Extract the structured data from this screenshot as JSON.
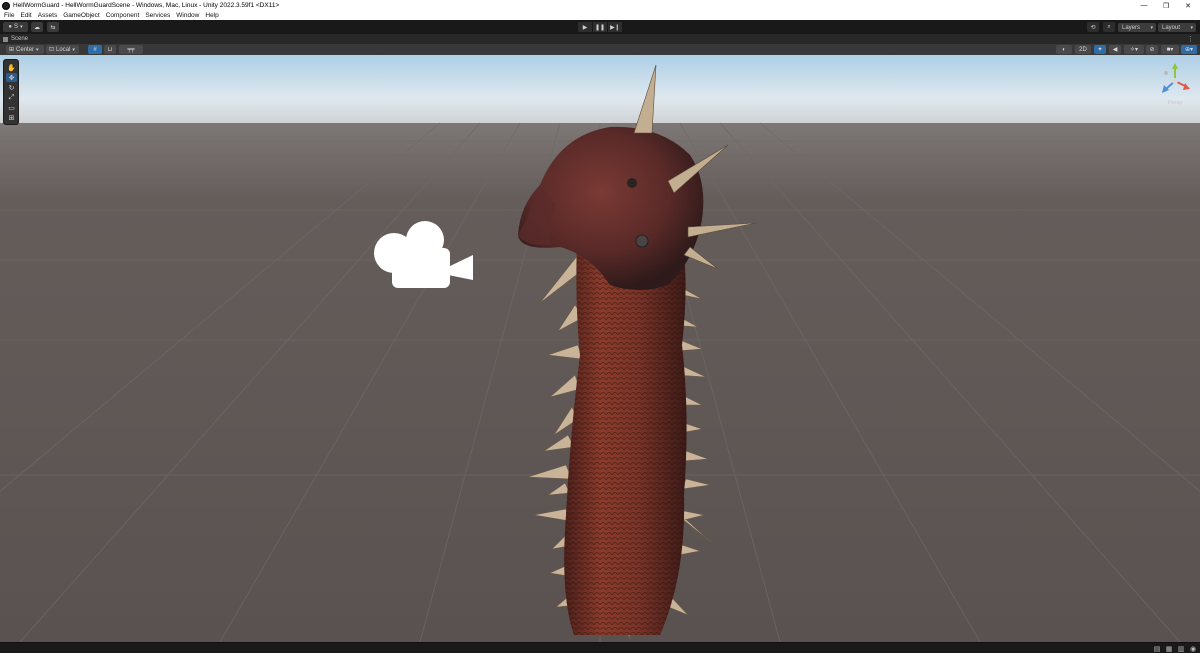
{
  "window": {
    "title": "HellWormGuard - HellWormGuardScene - Windows, Mac, Linux - Unity 2022.3.59f1 <DX11>",
    "minimize_glyph": "—",
    "restore_glyph": "❐",
    "close_glyph": "✕"
  },
  "menu": [
    "File",
    "Edit",
    "Assets",
    "GameObject",
    "Component",
    "Services",
    "Window",
    "Help"
  ],
  "toolbar": {
    "account_label": "S",
    "play_glyph": "▶",
    "pause_glyph": "❚❚",
    "step_glyph": "▶❙",
    "layers_label": "Layers",
    "layout_label": "Layout"
  },
  "scene_tab": {
    "label": "Scene"
  },
  "scene_toolbar": {
    "pivot_label": "Center",
    "space_label": "Local",
    "mode_2d_label": "2D"
  },
  "gizmo": {
    "label": "Persp"
  },
  "colors": {
    "accent_blue": "#2e6ea8",
    "editor_dark": "#191919",
    "sky": "#cfe2ee",
    "ground": "#5f5855",
    "worm_body": "#7a3428"
  }
}
